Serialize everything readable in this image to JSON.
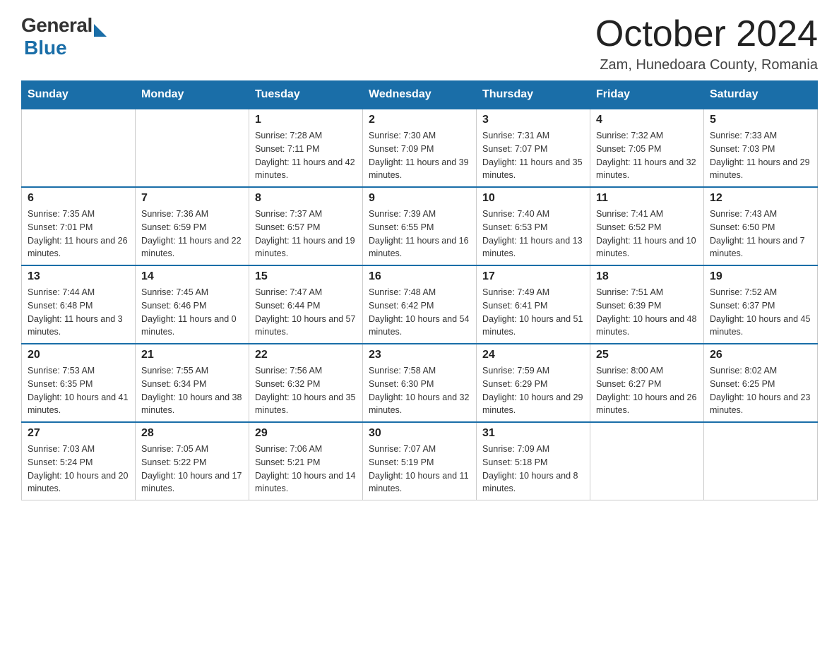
{
  "header": {
    "title": "October 2024",
    "location": "Zam, Hunedoara County, Romania"
  },
  "logo": {
    "general": "General",
    "blue": "Blue"
  },
  "days_of_week": [
    "Sunday",
    "Monday",
    "Tuesday",
    "Wednesday",
    "Thursday",
    "Friday",
    "Saturday"
  ],
  "weeks": [
    [
      {
        "day": "",
        "sunrise": "",
        "sunset": "",
        "daylight": ""
      },
      {
        "day": "",
        "sunrise": "",
        "sunset": "",
        "daylight": ""
      },
      {
        "day": "1",
        "sunrise": "Sunrise: 7:28 AM",
        "sunset": "Sunset: 7:11 PM",
        "daylight": "Daylight: 11 hours and 42 minutes."
      },
      {
        "day": "2",
        "sunrise": "Sunrise: 7:30 AM",
        "sunset": "Sunset: 7:09 PM",
        "daylight": "Daylight: 11 hours and 39 minutes."
      },
      {
        "day": "3",
        "sunrise": "Sunrise: 7:31 AM",
        "sunset": "Sunset: 7:07 PM",
        "daylight": "Daylight: 11 hours and 35 minutes."
      },
      {
        "day": "4",
        "sunrise": "Sunrise: 7:32 AM",
        "sunset": "Sunset: 7:05 PM",
        "daylight": "Daylight: 11 hours and 32 minutes."
      },
      {
        "day": "5",
        "sunrise": "Sunrise: 7:33 AM",
        "sunset": "Sunset: 7:03 PM",
        "daylight": "Daylight: 11 hours and 29 minutes."
      }
    ],
    [
      {
        "day": "6",
        "sunrise": "Sunrise: 7:35 AM",
        "sunset": "Sunset: 7:01 PM",
        "daylight": "Daylight: 11 hours and 26 minutes."
      },
      {
        "day": "7",
        "sunrise": "Sunrise: 7:36 AM",
        "sunset": "Sunset: 6:59 PM",
        "daylight": "Daylight: 11 hours and 22 minutes."
      },
      {
        "day": "8",
        "sunrise": "Sunrise: 7:37 AM",
        "sunset": "Sunset: 6:57 PM",
        "daylight": "Daylight: 11 hours and 19 minutes."
      },
      {
        "day": "9",
        "sunrise": "Sunrise: 7:39 AM",
        "sunset": "Sunset: 6:55 PM",
        "daylight": "Daylight: 11 hours and 16 minutes."
      },
      {
        "day": "10",
        "sunrise": "Sunrise: 7:40 AM",
        "sunset": "Sunset: 6:53 PM",
        "daylight": "Daylight: 11 hours and 13 minutes."
      },
      {
        "day": "11",
        "sunrise": "Sunrise: 7:41 AM",
        "sunset": "Sunset: 6:52 PM",
        "daylight": "Daylight: 11 hours and 10 minutes."
      },
      {
        "day": "12",
        "sunrise": "Sunrise: 7:43 AM",
        "sunset": "Sunset: 6:50 PM",
        "daylight": "Daylight: 11 hours and 7 minutes."
      }
    ],
    [
      {
        "day": "13",
        "sunrise": "Sunrise: 7:44 AM",
        "sunset": "Sunset: 6:48 PM",
        "daylight": "Daylight: 11 hours and 3 minutes."
      },
      {
        "day": "14",
        "sunrise": "Sunrise: 7:45 AM",
        "sunset": "Sunset: 6:46 PM",
        "daylight": "Daylight: 11 hours and 0 minutes."
      },
      {
        "day": "15",
        "sunrise": "Sunrise: 7:47 AM",
        "sunset": "Sunset: 6:44 PM",
        "daylight": "Daylight: 10 hours and 57 minutes."
      },
      {
        "day": "16",
        "sunrise": "Sunrise: 7:48 AM",
        "sunset": "Sunset: 6:42 PM",
        "daylight": "Daylight: 10 hours and 54 minutes."
      },
      {
        "day": "17",
        "sunrise": "Sunrise: 7:49 AM",
        "sunset": "Sunset: 6:41 PM",
        "daylight": "Daylight: 10 hours and 51 minutes."
      },
      {
        "day": "18",
        "sunrise": "Sunrise: 7:51 AM",
        "sunset": "Sunset: 6:39 PM",
        "daylight": "Daylight: 10 hours and 48 minutes."
      },
      {
        "day": "19",
        "sunrise": "Sunrise: 7:52 AM",
        "sunset": "Sunset: 6:37 PM",
        "daylight": "Daylight: 10 hours and 45 minutes."
      }
    ],
    [
      {
        "day": "20",
        "sunrise": "Sunrise: 7:53 AM",
        "sunset": "Sunset: 6:35 PM",
        "daylight": "Daylight: 10 hours and 41 minutes."
      },
      {
        "day": "21",
        "sunrise": "Sunrise: 7:55 AM",
        "sunset": "Sunset: 6:34 PM",
        "daylight": "Daylight: 10 hours and 38 minutes."
      },
      {
        "day": "22",
        "sunrise": "Sunrise: 7:56 AM",
        "sunset": "Sunset: 6:32 PM",
        "daylight": "Daylight: 10 hours and 35 minutes."
      },
      {
        "day": "23",
        "sunrise": "Sunrise: 7:58 AM",
        "sunset": "Sunset: 6:30 PM",
        "daylight": "Daylight: 10 hours and 32 minutes."
      },
      {
        "day": "24",
        "sunrise": "Sunrise: 7:59 AM",
        "sunset": "Sunset: 6:29 PM",
        "daylight": "Daylight: 10 hours and 29 minutes."
      },
      {
        "day": "25",
        "sunrise": "Sunrise: 8:00 AM",
        "sunset": "Sunset: 6:27 PM",
        "daylight": "Daylight: 10 hours and 26 minutes."
      },
      {
        "day": "26",
        "sunrise": "Sunrise: 8:02 AM",
        "sunset": "Sunset: 6:25 PM",
        "daylight": "Daylight: 10 hours and 23 minutes."
      }
    ],
    [
      {
        "day": "27",
        "sunrise": "Sunrise: 7:03 AM",
        "sunset": "Sunset: 5:24 PM",
        "daylight": "Daylight: 10 hours and 20 minutes."
      },
      {
        "day": "28",
        "sunrise": "Sunrise: 7:05 AM",
        "sunset": "Sunset: 5:22 PM",
        "daylight": "Daylight: 10 hours and 17 minutes."
      },
      {
        "day": "29",
        "sunrise": "Sunrise: 7:06 AM",
        "sunset": "Sunset: 5:21 PM",
        "daylight": "Daylight: 10 hours and 14 minutes."
      },
      {
        "day": "30",
        "sunrise": "Sunrise: 7:07 AM",
        "sunset": "Sunset: 5:19 PM",
        "daylight": "Daylight: 10 hours and 11 minutes."
      },
      {
        "day": "31",
        "sunrise": "Sunrise: 7:09 AM",
        "sunset": "Sunset: 5:18 PM",
        "daylight": "Daylight: 10 hours and 8 minutes."
      },
      {
        "day": "",
        "sunrise": "",
        "sunset": "",
        "daylight": ""
      },
      {
        "day": "",
        "sunrise": "",
        "sunset": "",
        "daylight": ""
      }
    ]
  ]
}
